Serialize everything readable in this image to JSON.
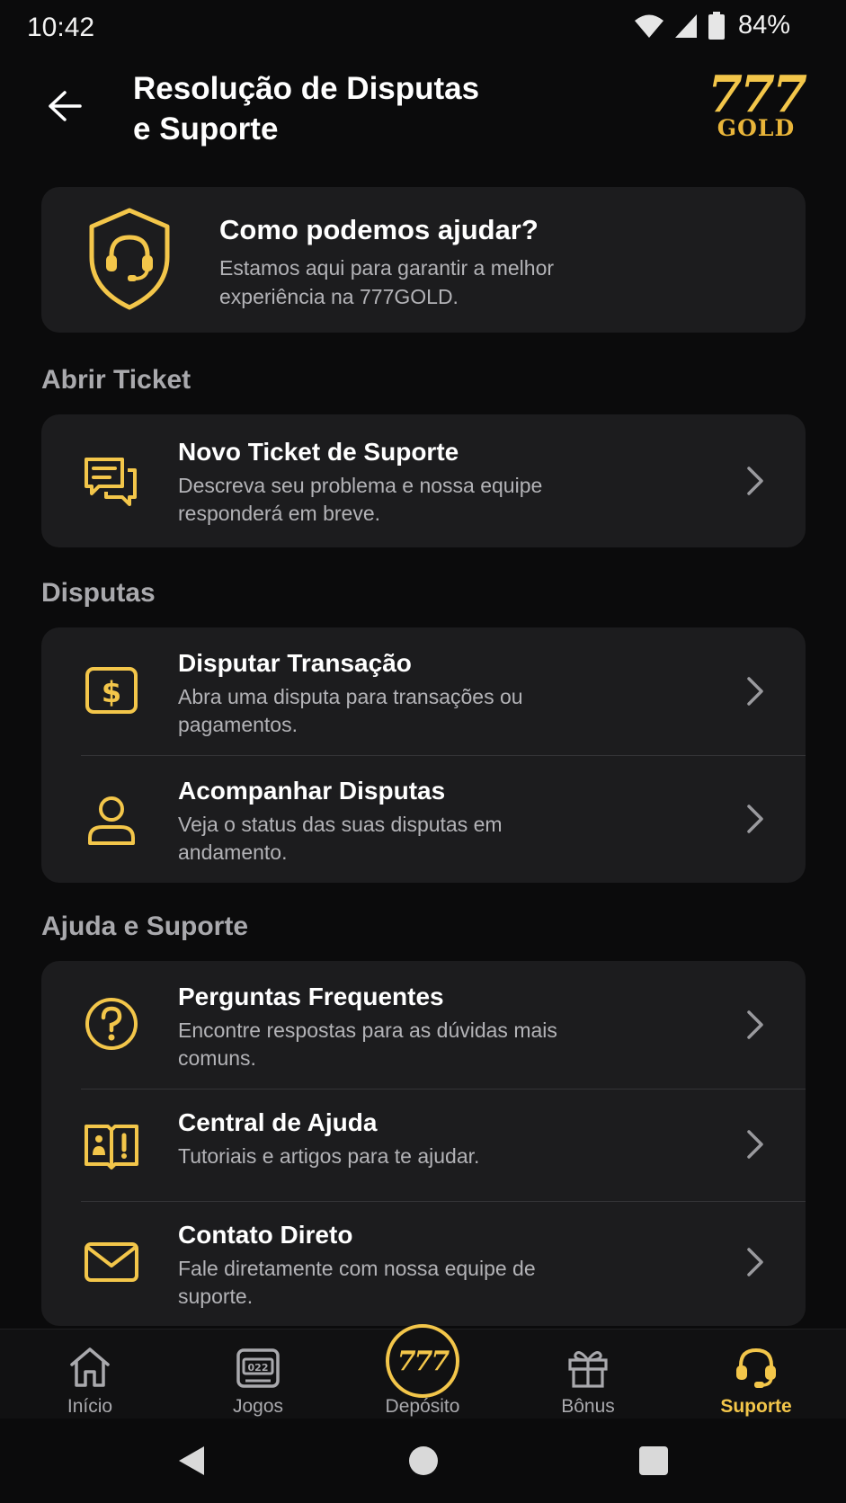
{
  "status_bar": {
    "time": "10:42",
    "battery": "84%"
  },
  "header": {
    "title_line1": "Resolução de Disputas",
    "title_line2": "e Suporte",
    "logo_top": "777",
    "logo_bottom": "GOLD"
  },
  "hero": {
    "title": "Como podemos ajudar?",
    "subtitle": "Estamos aqui para garantir a melhor experiência na 777GOLD.",
    "icon": "shield-headset-icon"
  },
  "sections": {
    "ticket": {
      "title": "Abrir Ticket",
      "items": [
        {
          "title": "Novo Ticket de Suporte",
          "subtitle": "Descreva seu problema e nossa equipe responderá em breve.",
          "icon": "chat-bubbles-icon"
        }
      ]
    },
    "disputes": {
      "title": "Disputas",
      "items": [
        {
          "title": "Disputar Transação",
          "subtitle": "Abra uma disputa para transações ou pagamentos.",
          "icon": "dollar-icon"
        },
        {
          "title": "Acompanhar Disputas",
          "subtitle": "Veja o status das suas disputas em andamento.",
          "icon": "user-icon"
        }
      ]
    },
    "help": {
      "title": "Ajuda e Suporte",
      "items": [
        {
          "title": "Perguntas Frequentes",
          "subtitle": "Encontre respostas para as dúvidas mais comuns.",
          "icon": "question-icon"
        },
        {
          "title": "Central de Ajuda",
          "subtitle": "Tutoriais e artigos para te ajudar.",
          "icon": "book-icon"
        },
        {
          "title": "Contato Direto",
          "subtitle": "Fale diretamente com nossa equipe de suporte.",
          "icon": "mail-icon"
        }
      ]
    }
  },
  "bottom_nav": {
    "items": [
      {
        "label": "Início",
        "icon": "home-icon"
      },
      {
        "label": "Jogos",
        "icon": "slot-machine-icon"
      },
      {
        "label": "Depósito",
        "icon": "777-coin-icon",
        "badge": "777"
      },
      {
        "label": "Bônus",
        "icon": "gift-icon"
      },
      {
        "label": "Suporte",
        "icon": "headset-icon",
        "active": true
      }
    ]
  },
  "colors": {
    "accent": "#f3c64a",
    "background": "#0b0b0c",
    "card": "#1c1c1e",
    "muted_text": "#b3b3b7"
  }
}
